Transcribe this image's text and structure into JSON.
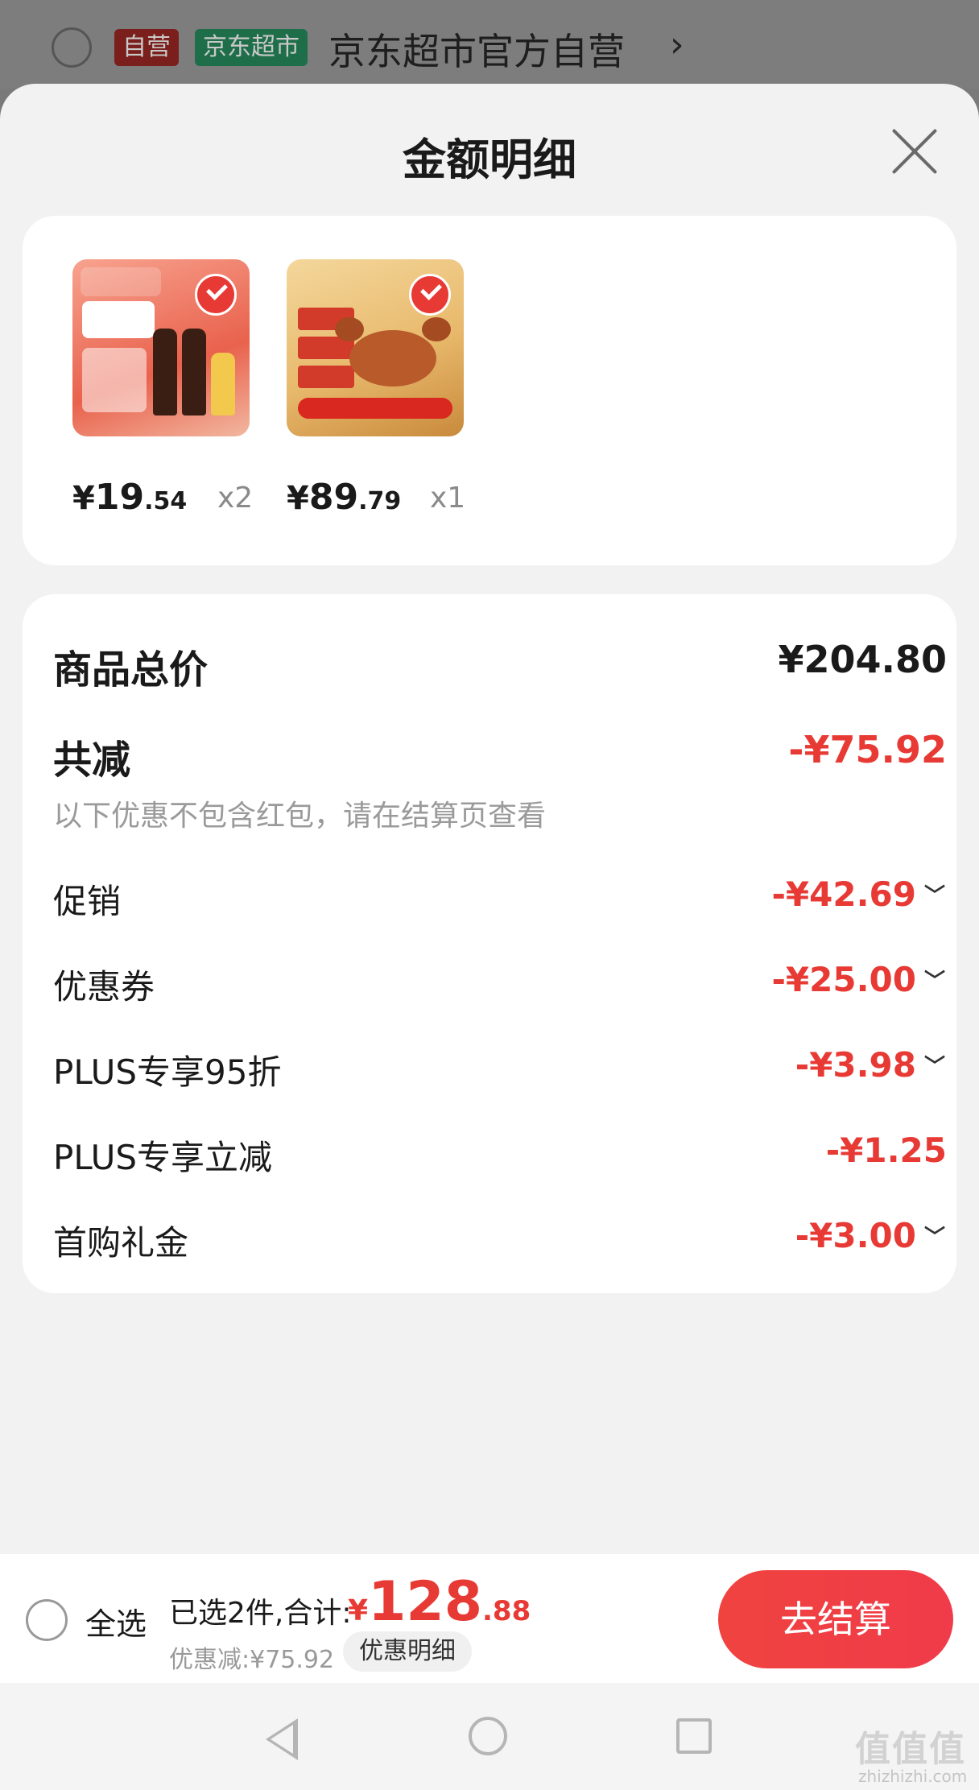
{
  "store": {
    "tag_self": "自营",
    "tag_market": "京东超市",
    "name": "京东超市官方自营",
    "chevron": "›"
  },
  "sheet": {
    "title": "金额明细",
    "close_icon": "close-icon"
  },
  "products": [
    {
      "price_yen": "¥",
      "price_int": "19",
      "price_dec": ".54",
      "qty": "x2",
      "checked": true
    },
    {
      "price_yen": "¥",
      "price_int": "89",
      "price_dec": ".79",
      "qty": "x1",
      "checked": true
    }
  ],
  "breakdown": {
    "total_label": "商品总价",
    "total_amount": "¥204.80",
    "reduce_label": "共减",
    "reduce_amount": "-¥75.92",
    "note": "以下优惠不包含红包，请在结算页查看",
    "items": [
      {
        "label": "促销",
        "amount": "-¥42.69",
        "expandable": true
      },
      {
        "label": "优惠券",
        "amount": "-¥25.00",
        "expandable": true
      },
      {
        "label": "PLUS专享95折",
        "amount": "-¥3.98",
        "expandable": true
      },
      {
        "label": "PLUS专享立减",
        "amount": "-¥1.25",
        "expandable": false
      },
      {
        "label": "首购礼金",
        "amount": "-¥3.00",
        "expandable": true
      }
    ]
  },
  "checkout": {
    "select_all": "全选",
    "summary": "已选2件,合计:",
    "total_yen": "¥",
    "total_int": "128",
    "total_dec": ".88",
    "discount": "优惠减:¥75.92",
    "detail_button": "优惠明细",
    "checkout_button": "去结算"
  },
  "watermark": {
    "text": "值值值",
    "sub": "zhizhizhi.com"
  },
  "colors": {
    "accent": "#e83a35",
    "self_tag": "#7a1f1c",
    "market_tag": "#1f6e4a"
  }
}
